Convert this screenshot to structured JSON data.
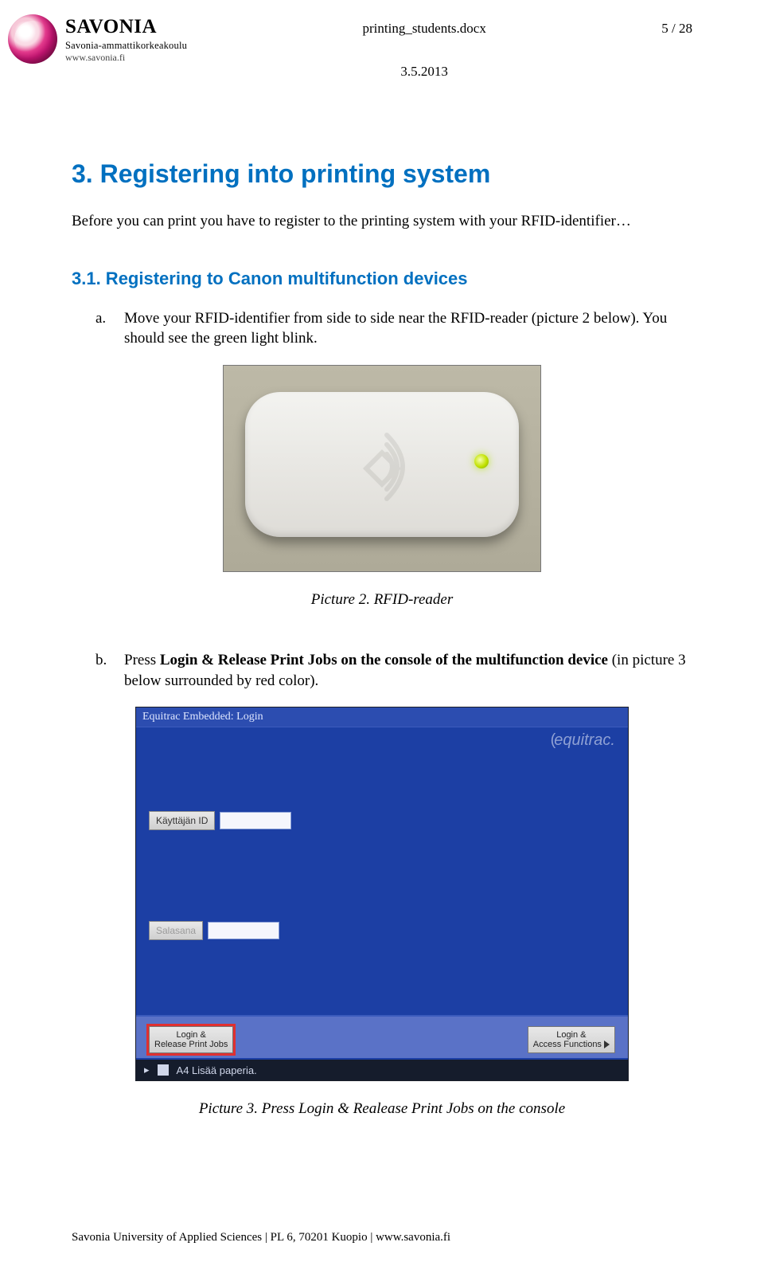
{
  "header": {
    "logo_name": "SAVONIA",
    "logo_sub1": "Savonia-ammattikorkeakoulu",
    "logo_sub2": "www.savonia.fi",
    "doc_name": "printing_students.docx",
    "doc_date": "3.5.2013",
    "page_indicator": "5 / 28"
  },
  "body": {
    "h1": "3. Registering into printing system",
    "intro": "Before you can print you have to register to the printing system with your RFID-identifier…",
    "h2": "3.1. Registering to Canon multifunction devices",
    "steps": {
      "a_marker": "a.",
      "a_text": "Move your RFID-identifier from side to side near the RFID-reader (picture 2 below). You should see the green light blink.",
      "b_marker": "b.",
      "b_pre": "Press ",
      "b_bold": "Login & Release Print Jobs on the console of the multifunction device",
      "b_post": " (in picture 3 below surrounded by red color)."
    },
    "caption2": "Picture 2. RFID-reader",
    "caption3": "Picture 3. Press Login & Realease Print Jobs on the console"
  },
  "console": {
    "titlebar": "Equitrac Embedded: Login",
    "brand": "equitrac.",
    "field1_label": "Käyttäjän ID",
    "field2_label": "Salasana",
    "btn_left_line1": "Login &",
    "btn_left_line2": "Release Print Jobs",
    "btn_right_line1": "Login &",
    "btn_right_line2": "Access Functions",
    "status_text": "A4  Lisää paperia."
  },
  "footer": "Savonia University of Applied Sciences | PL 6, 70201 Kuopio | www.savonia.fi"
}
